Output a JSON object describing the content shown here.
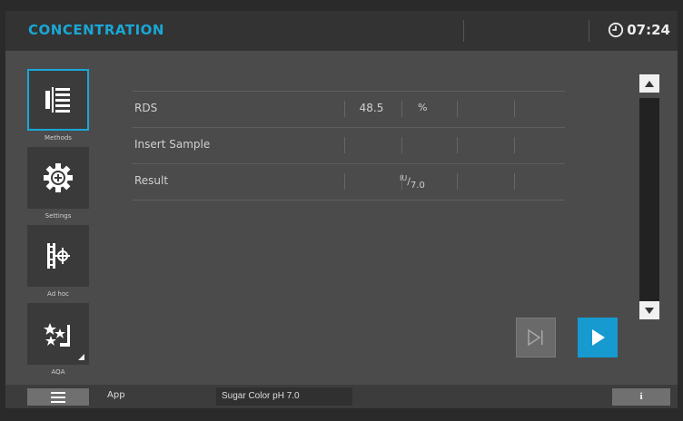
{
  "header": {
    "title": "CONCENTRATION",
    "time": "07:24",
    "clock_icon": "clock-icon"
  },
  "sidebar": {
    "items": [
      {
        "label": "Methods",
        "icon": "methods-list-icon",
        "active": true
      },
      {
        "label": "Settings",
        "icon": "gear-icon",
        "active": false
      },
      {
        "label": "Ad hoc",
        "icon": "ad-hoc-measure-icon",
        "active": false
      },
      {
        "label": "AQA",
        "icon": "aqa-stars-icon",
        "active": false
      }
    ]
  },
  "table": {
    "rows": [
      {
        "label": "RDS",
        "value": "48.5",
        "unit": "%"
      },
      {
        "label": "Insert Sample",
        "value": "",
        "unit": ""
      },
      {
        "label": "Result",
        "value": "",
        "unit_sup": "IU",
        "unit_sub": "7.0"
      }
    ]
  },
  "scrollbar": {
    "up_icon": "scroll-up-icon",
    "down_icon": "scroll-down-icon"
  },
  "actions": {
    "skip_icon": "skip-icon",
    "play_icon": "play-icon"
  },
  "footer": {
    "menu_icon": "hamburger-menu-icon",
    "app_label": "App",
    "method_name": "Sugar Color pH 7.0",
    "info_label": "i"
  },
  "colors": {
    "accent": "#1aa7d6",
    "background": "#4b4b4b",
    "header": "#333333",
    "play_button": "#169ad0"
  }
}
